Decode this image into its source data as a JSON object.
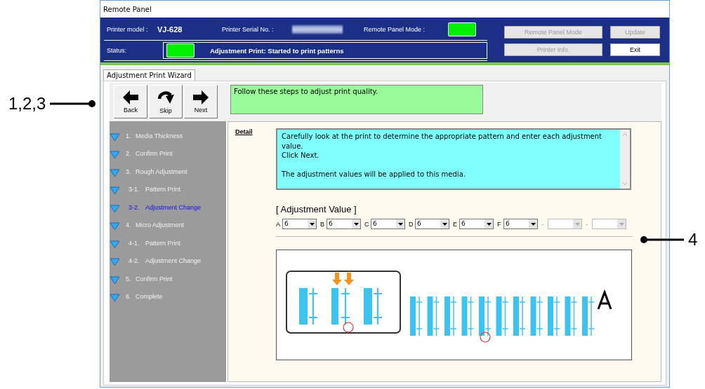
{
  "window": {
    "title": "Remote Panel"
  },
  "header": {
    "model_label": "Printer model :",
    "model_value": "VJ-628",
    "serial_label": "Printer Serial No. :",
    "mode_label": "Remote Panel Mode :",
    "mode_on": true,
    "status_label": "Status:",
    "status_on": true,
    "status_text": "Adjustment Print: Started to print patterns"
  },
  "buttons": [
    {
      "label": "Remote Panel Mode",
      "disabled": true
    },
    {
      "label": "Update",
      "disabled": true
    },
    {
      "label": "Printer Info.",
      "disabled": true
    },
    {
      "label": "Exit",
      "disabled": false
    }
  ],
  "tabs": [
    {
      "label": "Adjustment Print Wizard",
      "selected": true
    }
  ],
  "toolbar": [
    {
      "label": "Back",
      "kind": "back"
    },
    {
      "label": "Skip",
      "kind": "skip"
    },
    {
      "label": "Next",
      "kind": "next"
    }
  ],
  "instruction": "Follow these steps to adjust print quality.",
  "steps": [
    {
      "number": "1.",
      "label": "Media Thickness",
      "selected": false
    },
    {
      "number": "2.",
      "label": "Confirm Print",
      "selected": false
    },
    {
      "number": "3.",
      "label": "Rough Adjustment",
      "selected": false,
      "children": [
        {
          "number": "3-1.",
          "label": "Pattern Print",
          "selected": false
        },
        {
          "number": "3-2.",
          "label": "Adjustment Change",
          "selected": true
        }
      ]
    },
    {
      "number": "4.",
      "label": "Micro Adjustment",
      "selected": false,
      "children": [
        {
          "number": "4-1.",
          "label": "Pattern Print",
          "selected": false
        },
        {
          "number": "4-2.",
          "label": "Adjustment Change",
          "selected": false
        }
      ]
    },
    {
      "number": "5.",
      "label": "Confirm Print",
      "selected": false
    },
    {
      "number": "6.",
      "label": "Complete",
      "selected": false
    }
  ],
  "detail": {
    "label": "Detail",
    "paragraphs": [
      [
        "Carefully look at the print to determine the appropriate pattern and enter each adjustment value.",
        "Click Next."
      ],
      [
        "The adjustment values will be applied to this media."
      ]
    ]
  },
  "adjustment": {
    "title": "[ Adjustment Value ]",
    "fields": [
      {
        "label": "A",
        "value": "6",
        "disabled": false
      },
      {
        "label": "B",
        "value": "6",
        "disabled": false
      },
      {
        "label": "C",
        "value": "6",
        "disabled": false
      },
      {
        "label": "D",
        "value": "6",
        "disabled": false
      },
      {
        "label": "E",
        "value": "6",
        "disabled": false
      },
      {
        "label": "F",
        "value": "6",
        "disabled": false
      },
      {
        "label": "-",
        "disabled": true
      },
      {
        "label": "-",
        "disabled": true
      }
    ]
  },
  "annotations": [
    {
      "label": "1,2,3"
    },
    {
      "label": "4"
    }
  ]
}
